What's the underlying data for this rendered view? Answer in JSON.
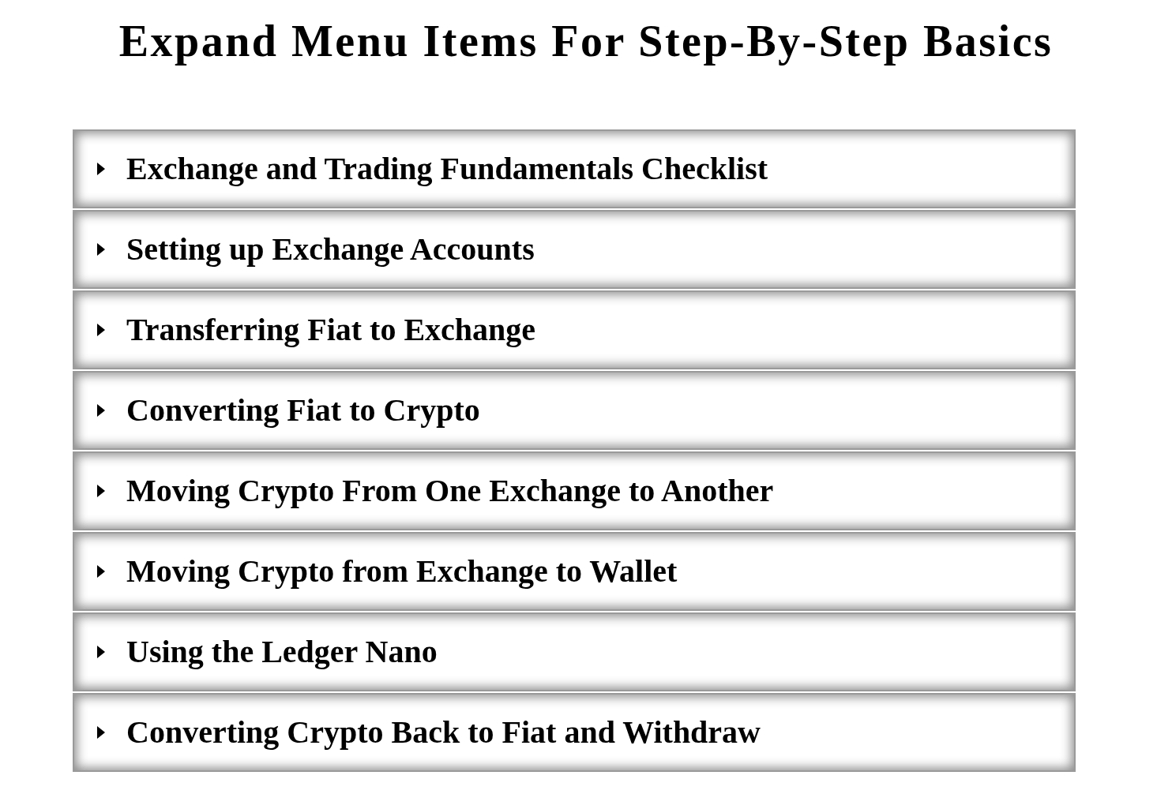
{
  "title": "Expand Menu Items For Step-By-Step Basics",
  "menu_items": [
    {
      "label": "Exchange and Trading Fundamentals Checklist",
      "expanded": false
    },
    {
      "label": "Setting up Exchange Accounts",
      "expanded": false
    },
    {
      "label": "Transferring Fiat to Exchange",
      "expanded": false
    },
    {
      "label": "Converting Fiat to Crypto",
      "expanded": false
    },
    {
      "label": "Moving Crypto From One Exchange to Another",
      "expanded": false
    },
    {
      "label": "Moving Crypto from Exchange to Wallet",
      "expanded": false
    },
    {
      "label": "Using the Ledger Nano",
      "expanded": false
    },
    {
      "label": "Converting Crypto Back to Fiat and Withdraw",
      "expanded": false
    }
  ]
}
